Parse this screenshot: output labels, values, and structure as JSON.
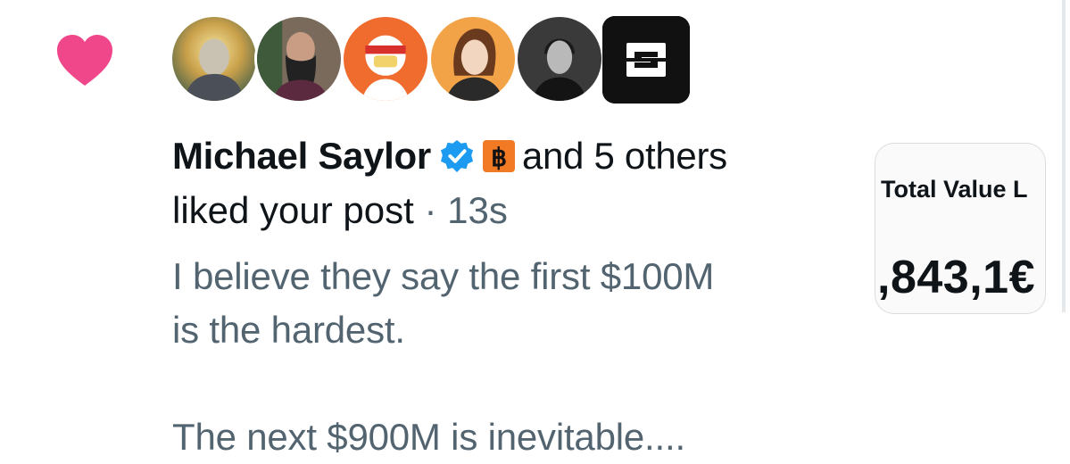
{
  "notification": {
    "type_icon": "heart-icon",
    "accent_color": "#f0468a",
    "actor_name": "Michael Saylor",
    "actor_badges": [
      "verified-badge-icon",
      "bitcoin-badge-icon"
    ],
    "others_text": "and 5 others",
    "action_text": "liked your post",
    "separator": "·",
    "timestamp": "13s",
    "avatars": [
      {
        "name": "avatar-1"
      },
      {
        "name": "avatar-2"
      },
      {
        "name": "avatar-3"
      },
      {
        "name": "avatar-4"
      },
      {
        "name": "avatar-5"
      },
      {
        "name": "avatar-6"
      }
    ]
  },
  "post": {
    "line1": "I believe they say the first $100M",
    "line2": "is the hardest.",
    "line3": "The next $900M is inevitable...."
  },
  "media_preview": {
    "label": "Total Value L",
    "value": ",843,1€"
  }
}
